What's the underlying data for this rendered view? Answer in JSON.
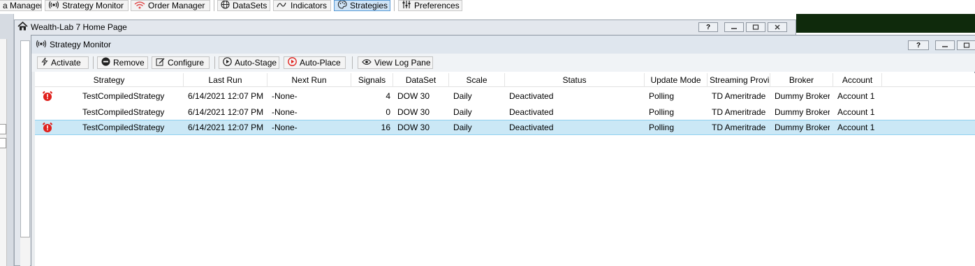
{
  "top_toolbar": {
    "items": [
      {
        "label": "a Manager",
        "icon": "none"
      },
      {
        "label": "Strategy Monitor",
        "icon": "broadcast-icon"
      },
      {
        "label": "Order Manager",
        "icon": "wifi-icon"
      },
      {
        "label": "DataSets",
        "icon": "globe-icon"
      },
      {
        "label": "Indicators",
        "icon": "wave-icon"
      },
      {
        "label": "Strategies",
        "icon": "palette-icon",
        "active": true
      },
      {
        "label": "Preferences",
        "icon": "sliders-icon"
      }
    ]
  },
  "home_window": {
    "title": "Wealth-Lab 7 Home Page",
    "help": "?"
  },
  "strategy_monitor": {
    "title": "Strategy Monitor",
    "help": "?",
    "toolbar": {
      "activate": "Activate",
      "remove": "Remove",
      "configure": "Configure",
      "auto_stage": "Auto-Stage",
      "auto_place": "Auto-Place",
      "view_log_pane": "View Log Pane"
    },
    "columns": {
      "strategy": "Strategy",
      "last_run": "Last Run",
      "next_run": "Next Run",
      "signals": "Signals",
      "dataset": "DataSet",
      "scale": "Scale",
      "status": "Status",
      "update_mode": "Update Mode",
      "streaming_provider": "Streaming Provi",
      "broker": "Broker",
      "account": "Account"
    },
    "rows": [
      {
        "alarm": true,
        "strategy": "TestCompiledStrategy",
        "last_run": "6/14/2021 12:07 PM",
        "next_run": "-None-",
        "signals": "4",
        "dataset": "DOW 30",
        "scale": "Daily",
        "status": "Deactivated",
        "update_mode": "Polling",
        "streaming_provider": "TD Ameritrade",
        "broker": "Dummy Broker",
        "account": "Account 1",
        "selected": false
      },
      {
        "alarm": false,
        "strategy": "TestCompiledStrategy",
        "last_run": "6/14/2021 12:07 PM",
        "next_run": "-None-",
        "signals": "0",
        "dataset": "DOW 30",
        "scale": "Daily",
        "status": "Deactivated",
        "update_mode": "Polling",
        "streaming_provider": "TD Ameritrade",
        "broker": "Dummy Broker",
        "account": "Account 1",
        "selected": false
      },
      {
        "alarm": true,
        "strategy": "TestCompiledStrategy",
        "last_run": "6/14/2021 12:07 PM",
        "next_run": "-None-",
        "signals": "16",
        "dataset": "DOW 30",
        "scale": "Daily",
        "status": "Deactivated",
        "update_mode": "Polling",
        "streaming_provider": "TD Ameritrade",
        "broker": "Dummy Broker",
        "account": "Account 1",
        "selected": true
      }
    ]
  },
  "colors": {
    "selection": "#cbe8f6",
    "alarm": "#e0201c"
  }
}
